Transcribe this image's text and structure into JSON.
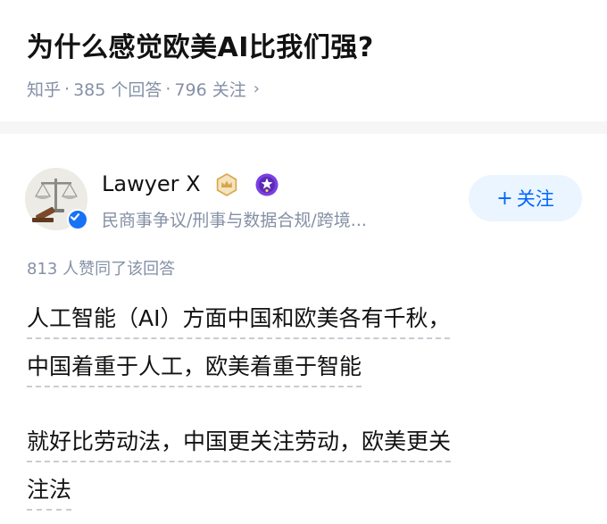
{
  "question": {
    "title": "为什么感觉欧美AI比我们强?",
    "source": "知乎",
    "answers_count": "385 个回答",
    "followers_count": "796 关注",
    "separator": "·",
    "chevron": "›"
  },
  "answer": {
    "author": {
      "name": "Lawyer X",
      "description": "民商事争议/刑事与数据合规/跨境...",
      "avatar_icon": "scales-of-justice-icon",
      "verified_icon": "verified-check-icon",
      "badges": [
        "crown-badge-icon",
        "star-badge-icon"
      ]
    },
    "follow_button": {
      "plus": "+",
      "label": "关注"
    },
    "vote_text": "813 人赞同了该回答",
    "paragraphs": [
      {
        "lines": [
          "人工智能（AI）方面中国和欧美各有千秋，",
          "中国着重于人工，欧美着重于智能"
        ]
      },
      {
        "lines": [
          "就好比劳动法，中国更关注劳动，欧美更关",
          "注法"
        ]
      }
    ]
  },
  "colors": {
    "accent": "#0066ff",
    "follow_bg": "#ebf5ff",
    "meta_gray": "#8590a6",
    "verified_blue": "#1772f6",
    "crown_gold": "#d7a64a",
    "star_purple": "#7b3fe4"
  }
}
